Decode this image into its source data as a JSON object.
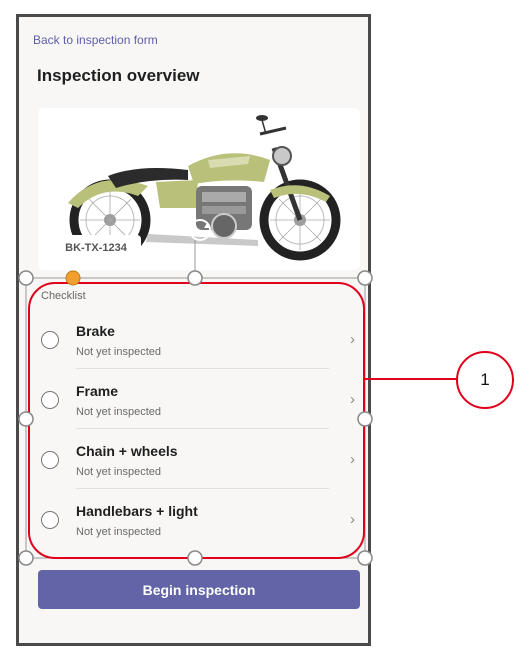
{
  "header": {
    "back_label": "Back to inspection form",
    "title": "Inspection overview"
  },
  "vehicle": {
    "plate": "BK-TX-1234",
    "image": "motorcycle-photo"
  },
  "checklist": {
    "label": "Checklist",
    "items": [
      {
        "title": "Brake",
        "status": "Not yet inspected"
      },
      {
        "title": "Frame",
        "status": "Not yet inspected"
      },
      {
        "title": "Chain + wheels",
        "status": "Not yet inspected"
      },
      {
        "title": "Handlebars + light",
        "status": "Not yet inspected"
      }
    ]
  },
  "actions": {
    "begin_label": "Begin inspection"
  },
  "annotation": {
    "callout": "1"
  },
  "colors": {
    "accent": "#6264a7",
    "selection_outline": "#e0001b",
    "background": "#f8f7f6"
  }
}
